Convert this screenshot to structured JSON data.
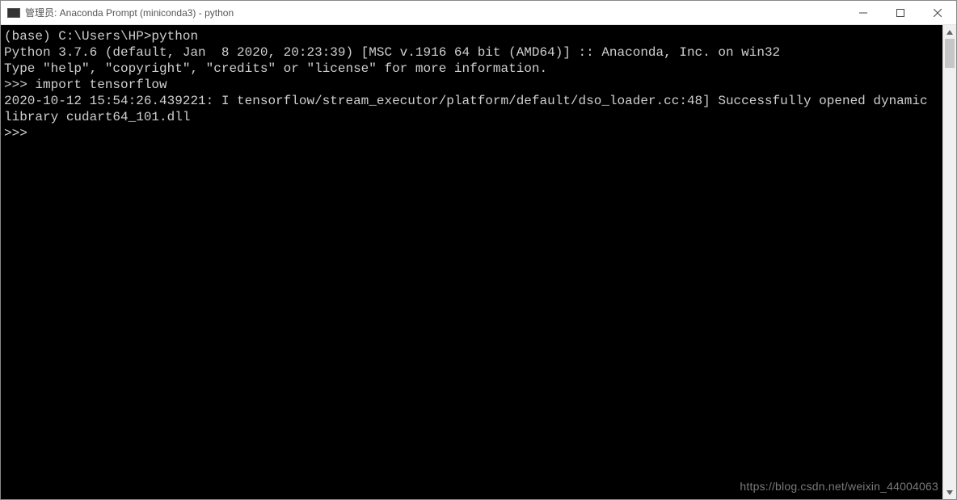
{
  "window": {
    "title": "管理员: Anaconda Prompt (miniconda3) - python"
  },
  "terminal": {
    "lines": [
      "(base) C:\\Users\\HP>python",
      "Python 3.7.6 (default, Jan  8 2020, 20:23:39) [MSC v.1916 64 bit (AMD64)] :: Anaconda, Inc. on win32",
      "Type \"help\", \"copyright\", \"credits\" or \"license\" for more information.",
      ">>> import tensorflow",
      "2020-10-12 15:54:26.439221: I tensorflow/stream_executor/platform/default/dso_loader.cc:48] Successfully opened dynamic library cudart64_101.dll",
      ">>> "
    ]
  },
  "watermark": "https://blog.csdn.net/weixin_44004063"
}
